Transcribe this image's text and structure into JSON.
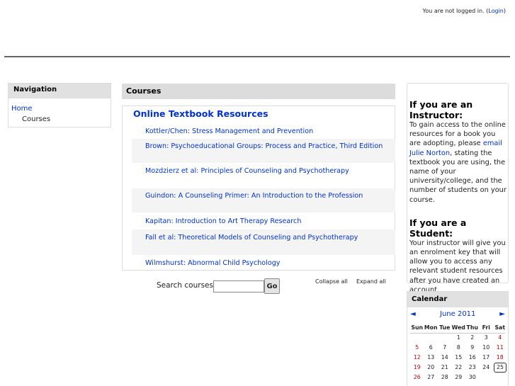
{
  "header": {
    "login_text": "You are not logged in. (",
    "login_link": "Login",
    "login_close": ")"
  },
  "navigation": {
    "title": "Navigation",
    "home": "Home",
    "courses": "Courses"
  },
  "courses": {
    "title": "Courses",
    "category": "Online Textbook Resources",
    "items": [
      "Kottler/Chen: Stress Management and Prevention",
      "Brown: Psychoeducational Groups: Process and Practice, Third Edition",
      "Mozdzierz et al: Principles of Counseling and Psychotherapy",
      "Guindon: A Counseling Primer: An Introduction to the Profession",
      "Kapitan: Introduction to Art Therapy Research",
      "Fall et al: Theoretical Models of Counseling and Psychotherapy",
      "Wilmshurst: Abnormal Child Psychology"
    ]
  },
  "search": {
    "label": "Search courses:",
    "go": "Go",
    "collapse": "Collapse all",
    "expand": "Expand all"
  },
  "info": {
    "instructor_title": "If you are an Instructor:",
    "instructor_text_1": "To gain access to the online resources for a book you are adopting, please ",
    "instructor_link": "email Julie Norton",
    "instructor_text_2": ", stating the textbook you are using, the name of your university/college, and the number of students on your course.",
    "student_title": "If you are a Student:",
    "student_text": "Your instructor will give you an enrolment key that will allow you to access any relevant student resources after you have created an account."
  },
  "calendar": {
    "title": "Calendar",
    "prev": "◄",
    "month": "June 2011",
    "next": "►",
    "days": [
      "Sun",
      "Mon",
      "Tue",
      "Wed",
      "Thu",
      "Fri",
      "Sat"
    ],
    "weeks": [
      [
        "",
        "",
        "",
        "1",
        "2",
        "3",
        "4"
      ],
      [
        "5",
        "6",
        "7",
        "8",
        "9",
        "10",
        "11"
      ],
      [
        "12",
        "13",
        "14",
        "15",
        "16",
        "17",
        "18"
      ],
      [
        "19",
        "20",
        "21",
        "22",
        "23",
        "24",
        "25"
      ],
      [
        "26",
        "27",
        "28",
        "29",
        "30",
        "",
        ""
      ]
    ],
    "today": "25",
    "weekend_color": "#cc0000"
  }
}
